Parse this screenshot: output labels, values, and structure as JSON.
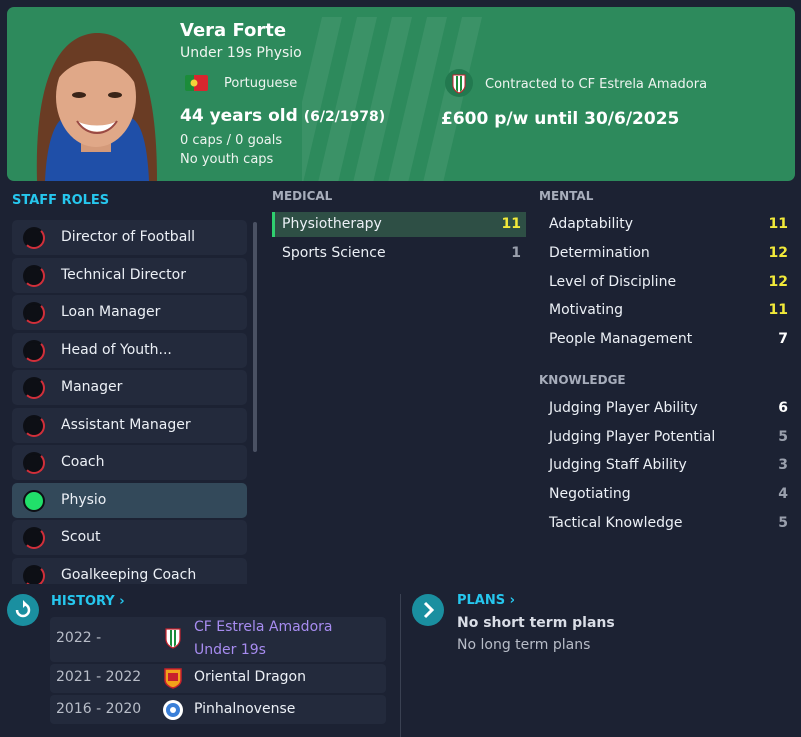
{
  "profile": {
    "name": "Vera Forte",
    "role": "Under 19s Physio",
    "nationality": "Portuguese",
    "age": "44 years old",
    "dob": "(6/2/1978)",
    "caps": "0 caps / 0 goals",
    "youth_caps": "No youth caps",
    "contract": "Contracted to CF Estrela Amadora",
    "wage": "£600 p/w until 30/6/2025",
    "header_color": "#2d8a5c"
  },
  "staff_roles": {
    "title": "STAFF ROLES",
    "items": [
      {
        "label": "Director of Football",
        "status": "red"
      },
      {
        "label": "Technical Director",
        "status": "red"
      },
      {
        "label": "Loan Manager",
        "status": "red"
      },
      {
        "label": "Head of Youth...",
        "status": "red"
      },
      {
        "label": "Manager",
        "status": "red"
      },
      {
        "label": "Assistant Manager",
        "status": "red"
      },
      {
        "label": "Coach",
        "status": "red"
      },
      {
        "label": "Physio",
        "status": "green"
      },
      {
        "label": "Scout",
        "status": "red"
      },
      {
        "label": "Goalkeeping Coach",
        "status": "red"
      }
    ]
  },
  "medical": {
    "title": "MEDICAL",
    "items": [
      {
        "label": "Physiotherapy",
        "value": "11"
      },
      {
        "label": "Sports Science",
        "value": "1"
      }
    ]
  },
  "mental": {
    "title": "MENTAL",
    "items": [
      {
        "label": "Adaptability",
        "value": "11"
      },
      {
        "label": "Determination",
        "value": "12"
      },
      {
        "label": "Level of Discipline",
        "value": "12"
      },
      {
        "label": "Motivating",
        "value": "11"
      },
      {
        "label": "People Management",
        "value": "7"
      }
    ]
  },
  "knowledge": {
    "title": "KNOWLEDGE",
    "items": [
      {
        "label": "Judging Player Ability",
        "value": "6"
      },
      {
        "label": "Judging Player Potential",
        "value": "5"
      },
      {
        "label": "Judging Staff Ability",
        "value": "3"
      },
      {
        "label": "Negotiating",
        "value": "4"
      },
      {
        "label": "Tactical Knowledge",
        "value": "5"
      }
    ]
  },
  "history": {
    "title": "HISTORY",
    "rows": [
      {
        "years": "2022 -",
        "club": "CF Estrela Amadora",
        "team": "Under 19s",
        "badge": "estrela-badge-icon"
      },
      {
        "years": "2021 - 2022",
        "club": "Oriental Dragon",
        "badge": "oriental-dragon-badge-icon"
      },
      {
        "years": "2016 - 2020",
        "club": "Pinhalnovense",
        "badge": "pinhalnovense-badge-icon"
      }
    ]
  },
  "plans": {
    "title": "PLANS",
    "short_term": "No short term plans",
    "long_term": "No long term plans"
  },
  "icons": {
    "history": "history-icon",
    "plans": "chevron-right-icon"
  }
}
